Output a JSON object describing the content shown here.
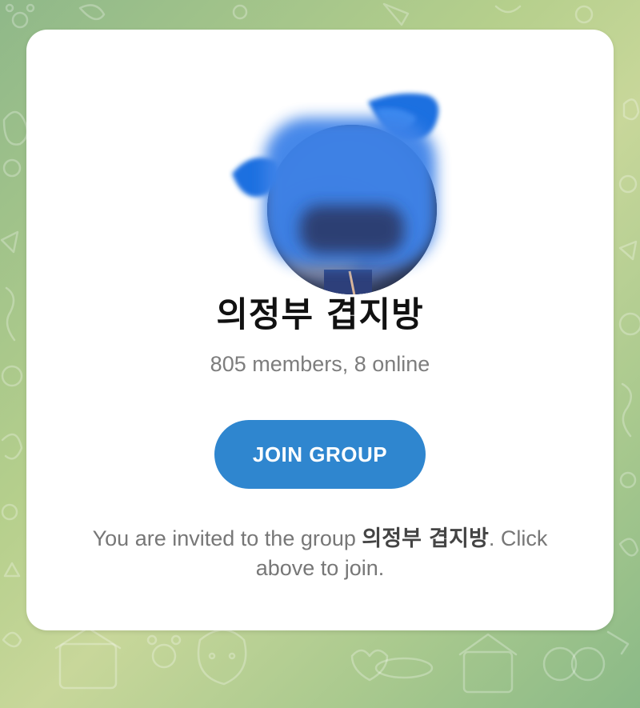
{
  "group": {
    "name": "의정부 겹지방",
    "members_status": "805 members, 8 online"
  },
  "join_button": {
    "label": "JOIN GROUP"
  },
  "invite_message": {
    "prefix": "You are invited to the group ",
    "group_name": "의정부 겹지방",
    "suffix": ". Click above to join."
  },
  "colors": {
    "accent": "#2f86cf",
    "card_background": "#ffffff",
    "secondary_text": "#7d7d7d"
  },
  "icons": {
    "avatar": "blurred-group-avatar",
    "wallpaper": "doodle-pattern-wallpaper"
  }
}
